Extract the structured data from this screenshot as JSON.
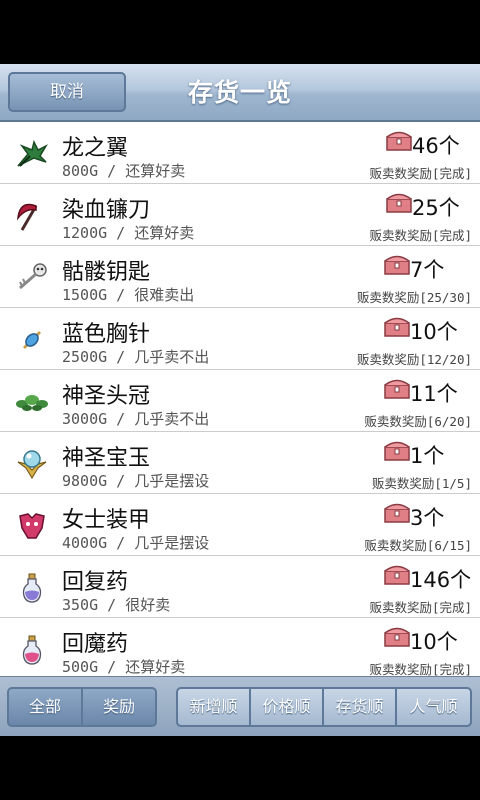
{
  "header": {
    "cancel_label": "取消",
    "title": "存货一览"
  },
  "items": [
    {
      "name": "龙之翼",
      "price_line": "800G / 还算好卖",
      "count": "46个",
      "reward": "贩卖数奖励[完成]",
      "icon": "dragon-wing-icon"
    },
    {
      "name": "染血镰刀",
      "price_line": "1200G / 还算好卖",
      "count": "25个",
      "reward": "贩卖数奖励[完成]",
      "icon": "scythe-icon"
    },
    {
      "name": "骷髅钥匙",
      "price_line": "1500G / 很难卖出",
      "count": "7个",
      "reward": "贩卖数奖励[25/30]",
      "icon": "skull-key-icon"
    },
    {
      "name": "蓝色胸针",
      "price_line": "2500G / 几乎卖不出",
      "count": "10个",
      "reward": "贩卖数奖励[12/20]",
      "icon": "brooch-icon"
    },
    {
      "name": "神圣头冠",
      "price_line": "3000G / 几乎卖不出",
      "count": "11个",
      "reward": "贩卖数奖励[6/20]",
      "icon": "laurel-crown-icon"
    },
    {
      "name": "神圣宝玉",
      "price_line": "9800G / 几乎是摆设",
      "count": "1个",
      "reward": "贩卖数奖励[1/5]",
      "icon": "orb-icon"
    },
    {
      "name": "女士装甲",
      "price_line": "4000G / 几乎是摆设",
      "count": "3个",
      "reward": "贩卖数奖励[6/15]",
      "icon": "armor-icon"
    },
    {
      "name": "回复药",
      "price_line": "350G / 很好卖",
      "count": "146个",
      "reward": "贩卖数奖励[完成]",
      "icon": "potion-icon"
    },
    {
      "name": "回魔药",
      "price_line": "500G / 还算好卖",
      "count": "10个",
      "reward": "贩卖数奖励[完成]",
      "icon": "mana-potion-icon"
    }
  ],
  "footer": {
    "filter_all": "全部",
    "filter_reward": "奖励",
    "sort_new": "新增顺",
    "sort_price": "价格顺",
    "sort_stock": "存货顺",
    "sort_popular": "人气顺"
  },
  "colors": {
    "header_blue": "#9fb6cf",
    "button_blue": "#7793b4",
    "chest_pink": "#e07f86"
  }
}
